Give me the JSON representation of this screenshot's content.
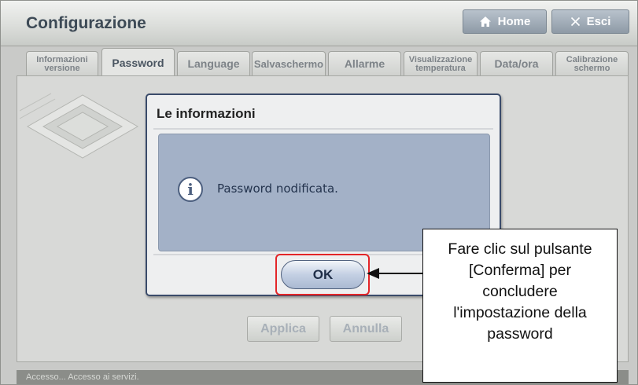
{
  "header": {
    "title": "Configurazione",
    "home_label": "Home",
    "exit_label": "Esci"
  },
  "tabs": [
    {
      "line1": "Informazioni",
      "line2": "versione"
    },
    {
      "line1": "Password",
      "line2": ""
    },
    {
      "line1": "Language",
      "line2": ""
    },
    {
      "line1": "Salvaschermo",
      "line2": ""
    },
    {
      "line1": "Allarme",
      "line2": ""
    },
    {
      "line1": "Visualizzazione",
      "line2": "temperatura"
    },
    {
      "line1": "Data/ora",
      "line2": ""
    },
    {
      "line1": "Calibrazione",
      "line2": "schermo"
    }
  ],
  "active_tab": "Password",
  "form": {
    "apply_label": "Applica",
    "cancel_label": "Annulla"
  },
  "status": {
    "text": "Accesso... Accesso ai servizi."
  },
  "dialog": {
    "title": "Le informazioni",
    "message": "Password nodificata.",
    "ok_label": "OK",
    "icon": "info-icon"
  },
  "callout": {
    "lines": [
      "Fare clic sul pulsante",
      "[Conferma] per",
      "concludere",
      "l'impostazione della",
      "password"
    ]
  },
  "colors": {
    "highlight": "#e32528",
    "dialog_border": "#3a4b6a",
    "dialog_body": "#a3b1c7"
  }
}
